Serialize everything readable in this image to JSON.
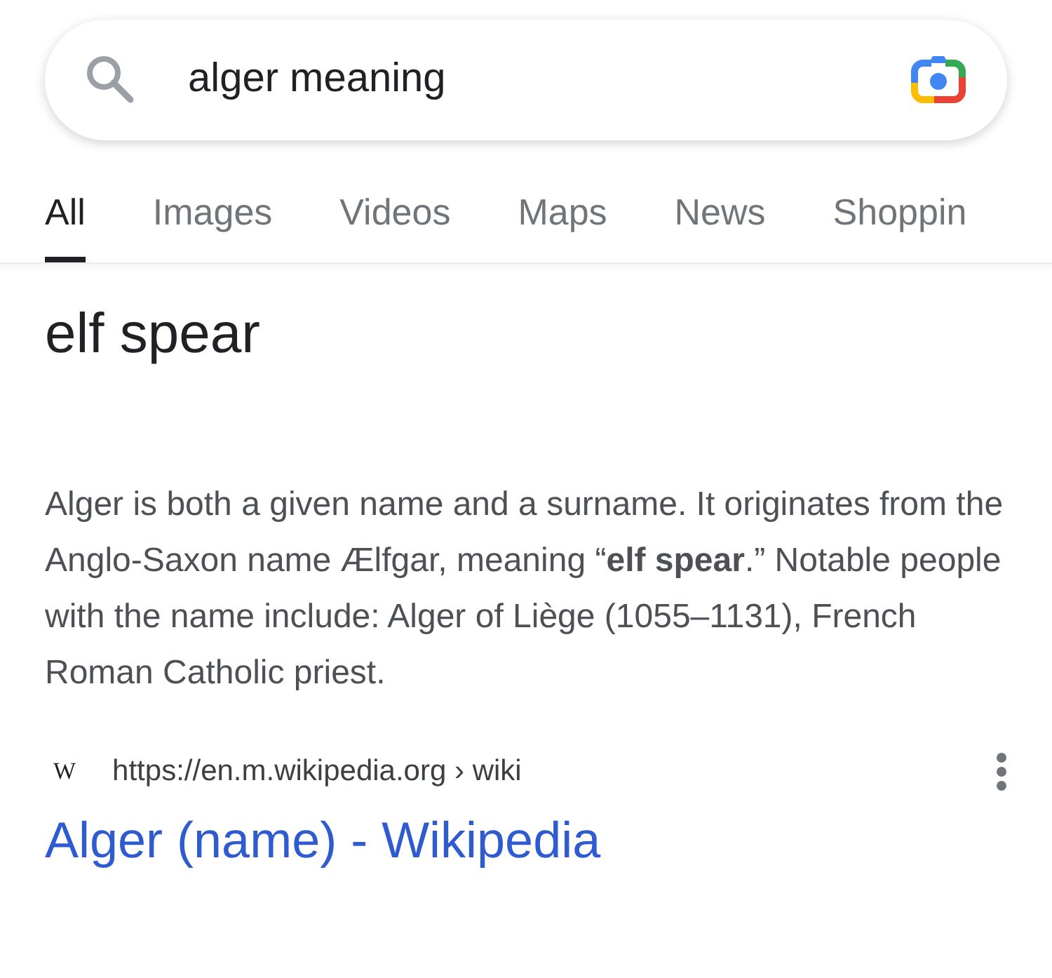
{
  "search": {
    "query": "alger meaning"
  },
  "tabs": [
    {
      "label": "All",
      "selected": true
    },
    {
      "label": "Images",
      "selected": false
    },
    {
      "label": "Videos",
      "selected": false
    },
    {
      "label": "Maps",
      "selected": false
    },
    {
      "label": "News",
      "selected": false
    },
    {
      "label": "Shoppin",
      "selected": false
    }
  ],
  "answer": {
    "heading": "elf spear",
    "description": "Alger is both a given name and a surname. It originates from the Anglo-Saxon name Ælfgar, meaning “**elf spear**.” Notable people with the name include: Alger of Liège (1055–1131), French Roman Catholic priest."
  },
  "result": {
    "favicon": "W",
    "url": "https://en.m.wikipedia.org › wiki",
    "title": "Alger (name) - Wikipedia"
  }
}
